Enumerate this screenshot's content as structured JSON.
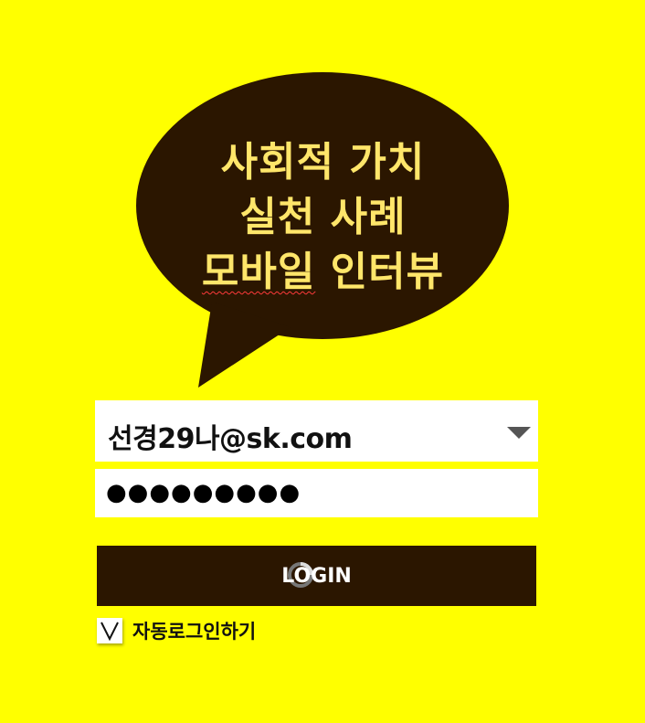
{
  "colors": {
    "background": "#ffff00",
    "bubble": "#2b1600",
    "bubble_text": "#ffe66a",
    "button": "#2b1600",
    "button_text": "#ffffff",
    "field": "#ffffff"
  },
  "bubble": {
    "lines": [
      "사회적 가치",
      "실천 사례",
      "모바일 인터뷰"
    ],
    "line3_marked_word": "모바일",
    "line3_rest": "인터뷰"
  },
  "login_form": {
    "email_value": "선경29나@sk.com",
    "email_icon": "chevron-down-icon",
    "password_masked": "●●●●●●●●●",
    "login_button_label": "LOGIN",
    "loading_icon": "spinner-icon",
    "auto_login_label": "자동로그인하기",
    "auto_login_checked": true,
    "checkbox_icon": "checkmark-icon"
  }
}
